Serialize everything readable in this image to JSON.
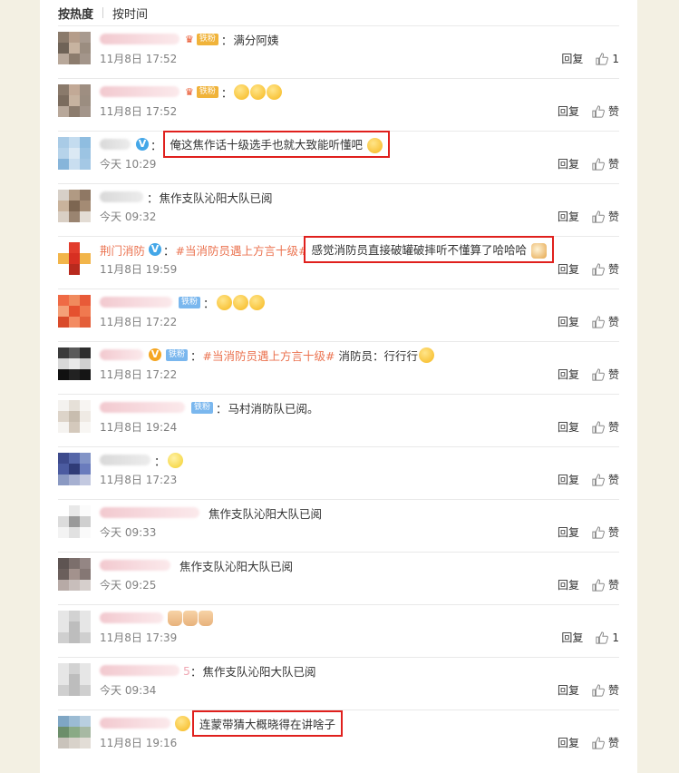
{
  "sort": {
    "hot": "按热度",
    "time": "按时间"
  },
  "comments": [
    {
      "text": "满分阿姨",
      "time": "11月8日 17:52",
      "reply": "回复",
      "like": "1"
    },
    {
      "text": "",
      "time": "11月8日 17:52",
      "reply": "回复",
      "like": "赞"
    },
    {
      "text": "俺这焦作话十级选手也就大致能听懂吧",
      "time": "今天 10:29",
      "reply": "回复",
      "like": "赞"
    },
    {
      "text": "焦作支队沁阳大队已阅",
      "time": "今天 09:32",
      "reply": "回复",
      "like": "赞"
    },
    {
      "username": "荆门消防",
      "topic": "#当消防员遇上方言十级#",
      "text": "感觉消防员直接破罐破摔听不懂算了哈哈哈",
      "time": "11月8日 19:59",
      "reply": "回复",
      "like": "赞"
    },
    {
      "text": "",
      "time": "11月8日 17:22",
      "reply": "回复",
      "like": "赞"
    },
    {
      "topic": "#当消防员遇上方言十级#",
      "text": "消防员：行行行",
      "time": "11月8日 17:22",
      "reply": "回复",
      "like": "赞"
    },
    {
      "text": "马村消防队已阅。",
      "time": "11月8日 19:24",
      "reply": "回复",
      "like": "赞"
    },
    {
      "text": "",
      "time": "11月8日 17:23",
      "reply": "回复",
      "like": "赞"
    },
    {
      "text": "焦作支队沁阳大队已阅",
      "time": "今天 09:33",
      "reply": "回复",
      "like": "赞"
    },
    {
      "text": "焦作支队沁阳大队已阅",
      "time": "今天 09:25",
      "reply": "回复",
      "like": "赞"
    },
    {
      "text": "",
      "time": "11月8日 17:39",
      "reply": "回复",
      "like": "1"
    },
    {
      "prefix": "5",
      "text": "焦作支队沁阳大队已阅",
      "time": "今天 09:34",
      "reply": "回复",
      "like": "赞"
    },
    {
      "text": "连蒙带猜大概晓得在讲啥子",
      "time": "11月8日 19:16",
      "reply": "回复",
      "like": "赞"
    }
  ],
  "badges": {
    "iron_fan": "铁粉",
    "v": "V"
  },
  "icons": [
    "thumbs-up-icon",
    "verified-v-icon",
    "crown-icon",
    "laughing-emoji",
    "cat-emoji",
    "thumbs-up-emoji",
    "smile-emoji"
  ],
  "colors": {
    "highlight_box": "#e0201d",
    "link_orange": "#eb7350",
    "verified_blue": "#44a7e8",
    "background": "#f3f0e3"
  }
}
